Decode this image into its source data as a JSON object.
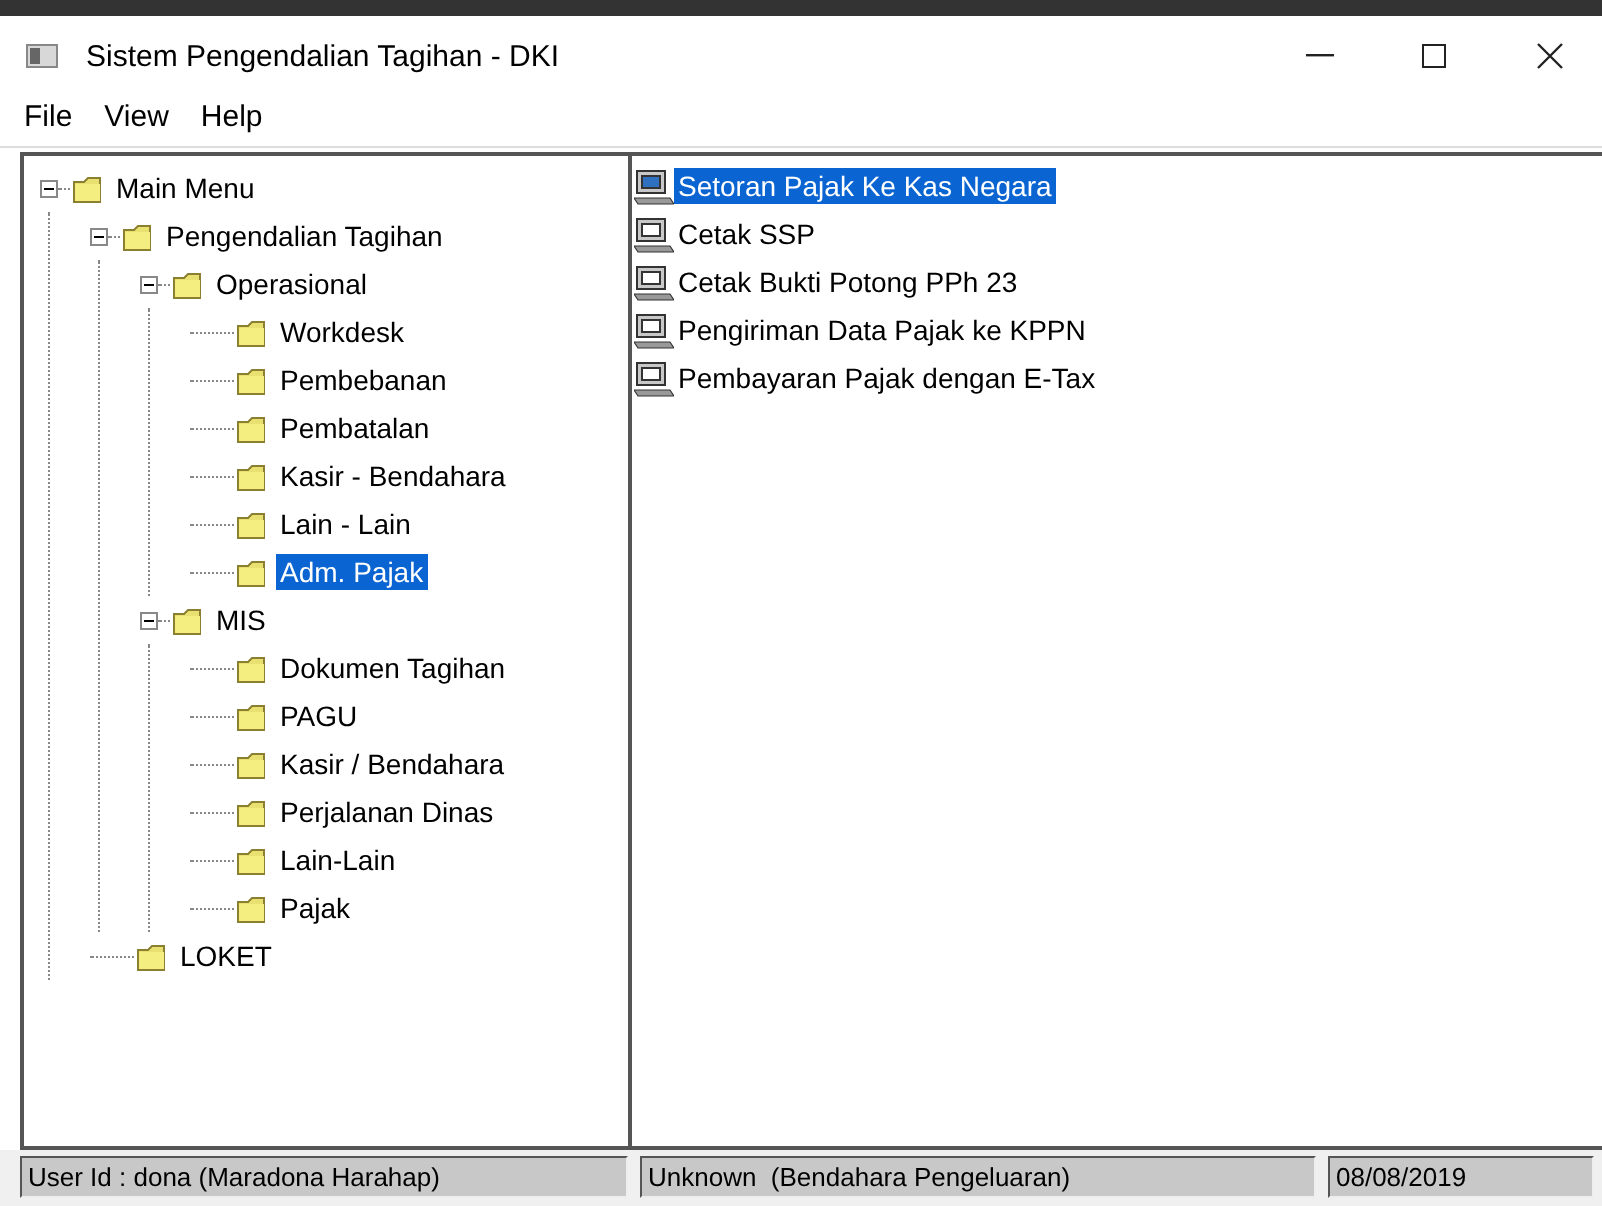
{
  "window": {
    "title": "Sistem Pengendalian Tagihan - DKI"
  },
  "menu": [
    "File",
    "View",
    "Help"
  ],
  "tree": [
    {
      "label": "Main Menu",
      "expanded": true,
      "selected": false,
      "children": [
        {
          "label": "Pengendalian Tagihan",
          "expanded": true,
          "selected": false,
          "children": [
            {
              "label": "Operasional",
              "expanded": true,
              "selected": false,
              "children": [
                {
                  "label": "Workdesk",
                  "selected": false
                },
                {
                  "label": "Pembebanan",
                  "selected": false
                },
                {
                  "label": "Pembatalan",
                  "selected": false
                },
                {
                  "label": "Kasir - Bendahara",
                  "selected": false
                },
                {
                  "label": "Lain - Lain",
                  "selected": false
                },
                {
                  "label": "Adm. Pajak",
                  "selected": true
                }
              ]
            },
            {
              "label": "MIS",
              "expanded": true,
              "selected": false,
              "children": [
                {
                  "label": "Dokumen Tagihan",
                  "selected": false
                },
                {
                  "label": "PAGU",
                  "selected": false
                },
                {
                  "label": "Kasir / Bendahara",
                  "selected": false
                },
                {
                  "label": "Perjalanan Dinas",
                  "selected": false
                },
                {
                  "label": "Lain-Lain",
                  "selected": false
                },
                {
                  "label": "Pajak",
                  "selected": false
                }
              ]
            }
          ]
        },
        {
          "label": "LOKET",
          "selected": false
        }
      ]
    }
  ],
  "items": [
    {
      "label": "Setoran Pajak Ke Kas Negara",
      "selected": true
    },
    {
      "label": "Cetak SSP",
      "selected": false
    },
    {
      "label": "Cetak Bukti Potong PPh 23",
      "selected": false
    },
    {
      "label": "Pengiriman Data Pajak ke KPPN",
      "selected": false
    },
    {
      "label": "Pembayaran Pajak dengan E-Tax",
      "selected": false
    }
  ],
  "status_bar": [
    "User Id : dona (Maradona Harahap)",
    "Unknown  (Bendahara Pengeluaran)",
    "08/08/2019"
  ]
}
